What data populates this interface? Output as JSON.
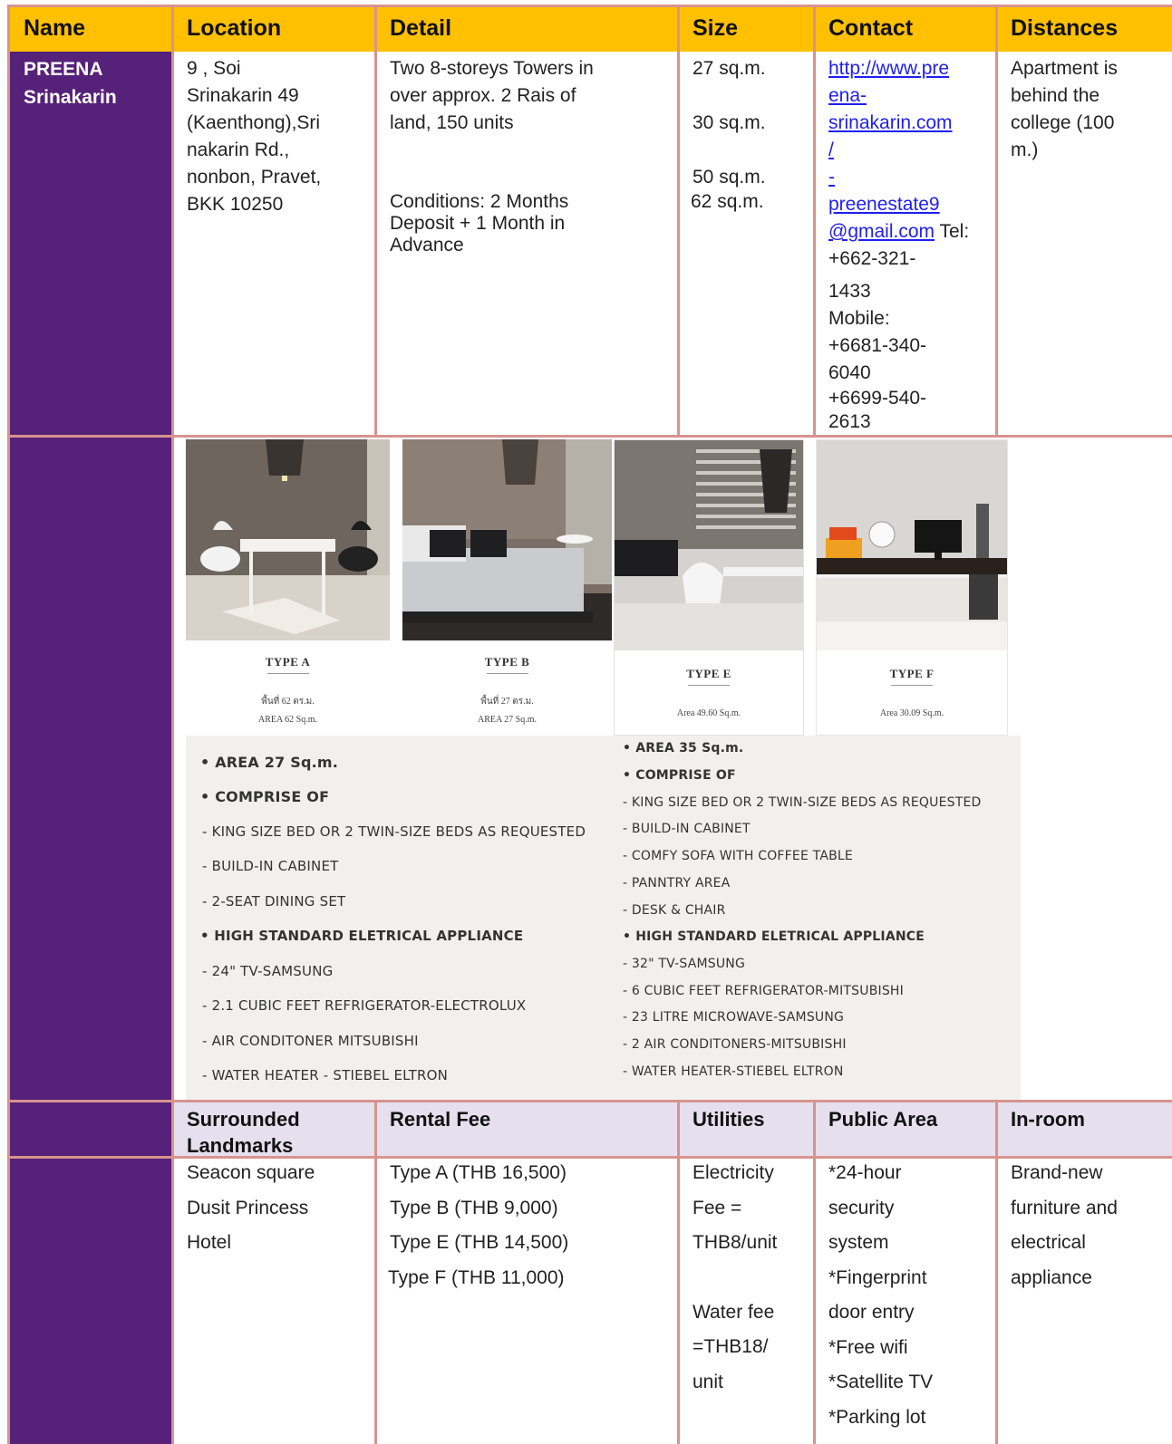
{
  "header": {
    "name": "Name",
    "location": "Location",
    "detail": "Detail",
    "size": "Size",
    "contact": "Contact",
    "distances": "Distances"
  },
  "property": {
    "name_line1": "PREENA",
    "name_line2": "Srinakarin",
    "location_lines": [
      "9 , Soi",
      "Srinakarin 49",
      "(Kaenthong),Sri",
      "nakarin Rd.,",
      "nonbon, Pravet,",
      "BKK 10250"
    ],
    "detail_lines": [
      "Two 8-storeys Towers in",
      "over approx. 2 Rais of",
      "land, 150 units"
    ],
    "conditions_lines": [
      "Conditions: 2 Months",
      "Deposit + 1 Month in",
      "Advance"
    ],
    "sizes": [
      "27 sq.m.",
      "30 sq.m.",
      "50 sq.m.",
      "62 sq.m."
    ],
    "contact": {
      "url_lines": [
        "http://www.pre",
        "ena-",
        "srinakarin.com",
        "/"
      ],
      "dash": "-",
      "email_lines": [
        "preenestate9",
        "@gmail.com"
      ],
      "tel_label": " Tel:",
      "tel_lines": [
        "+662-321-",
        "1433"
      ],
      "mobile_label": "Mobile:",
      "mobile_lines": [
        "+6681-340-",
        "6040",
        "+6699-540-",
        "2613"
      ]
    },
    "distance_lines": [
      "Apartment is",
      "behind the",
      "college (100",
      "m.)"
    ]
  },
  "gallery": [
    {
      "type": "TYPE A",
      "area_thai": "พื้นที่ 62 ตร.ม.",
      "area_en": "AREA 62 Sq.m."
    },
    {
      "type": "TYPE B",
      "area_thai": "พื้นที่ 27 ตร.ม.",
      "area_en": "AREA 27 Sq.m."
    },
    {
      "type": "TYPE E",
      "area_thai": "",
      "area_en": "Area 49.60 Sq.m."
    },
    {
      "type": "TYPE F",
      "area_thai": "",
      "area_en": "Area 30.09 Sq.m."
    }
  ],
  "spec_left": [
    "• AREA 27 Sq.m.",
    "• COMPRISE OF",
    "- KING SIZE BED OR 2 TWIN-SIZE BEDS AS REQUESTED",
    "- BUILD-IN CABINET",
    "- 2-SEAT DINING SET",
    "• HIGH STANDARD ELETRICAL APPLIANCE",
    "- 24\" TV-SAMSUNG",
    "- 2.1 CUBIC FEET REFRIGERATOR-ELECTROLUX",
    "- AIR CONDITONER MITSUBISHI",
    "- WATER HEATER - STIEBEL ELTRON"
  ],
  "spec_right": [
    "• AREA 35 Sq.m.",
    "• COMPRISE OF",
    "- KING SIZE BED OR 2 TWIN-SIZE BEDS AS REQUESTED",
    "- BUILD-IN CABINET",
    "- COMFY SOFA WITH COFFEE TABLE",
    "- PANNTRY AREA",
    "- DESK & CHAIR",
    "• HIGH STANDARD ELETRICAL APPLIANCE",
    "- 32\" TV-SAMSUNG",
    "- 6 CUBIC FEET REFRIGERATOR-MITSUBISHI",
    "- 23 LITRE MICROWAVE-SAMSUNG",
    "- 2 AIR CONDITONERS-MITSUBISHI",
    "- WATER HEATER-STIEBEL ELTRON"
  ],
  "subheader": {
    "landmarks_line1": "Surrounded",
    "landmarks_line2": "Landmarks",
    "rental": "Rental Fee",
    "utilities": "Utilities",
    "public": "Public Area",
    "inroom": "In-room"
  },
  "details": {
    "landmarks": [
      "Seacon square",
      "Dusit Princess",
      "Hotel"
    ],
    "rental": [
      "Type A (THB 16,500)",
      "Type B (THB 9,000)",
      "Type E (THB 14,500)",
      "Type F (THB 11,000)"
    ],
    "utilities_elec": [
      "Electricity",
      "Fee =",
      "THB8/unit"
    ],
    "utilities_water": [
      "Water fee",
      "=THB18/",
      "unit"
    ],
    "public": [
      "*24-hour",
      "security",
      "system",
      "*Fingerprint",
      "door entry",
      "*Free wifi",
      "*Satellite TV",
      "*Parking lot"
    ],
    "inroom": [
      "Brand-new",
      "furniture and",
      "electrical",
      "appliance"
    ]
  }
}
